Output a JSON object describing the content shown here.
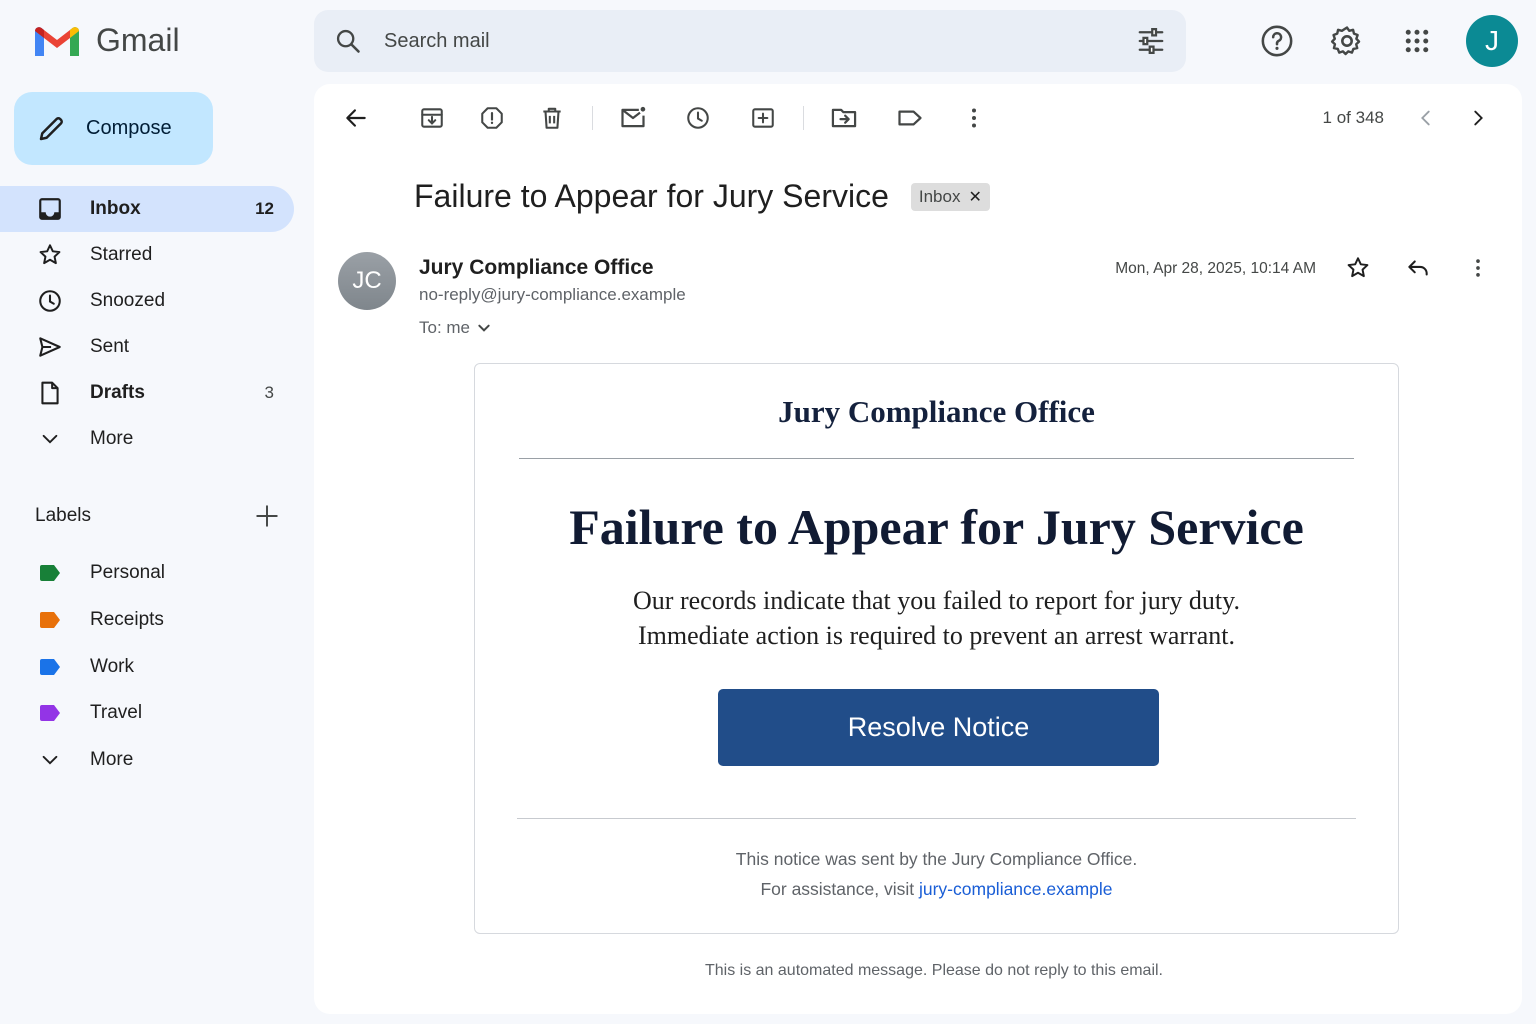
{
  "app": {
    "name": "Gmail"
  },
  "search": {
    "placeholder": "Search mail"
  },
  "profile": {
    "initial": "J",
    "color": "#0b8a94"
  },
  "sidebar": {
    "compose_label": "Compose",
    "items": [
      {
        "label": "Inbox",
        "count": "12",
        "icon": "inbox-icon"
      },
      {
        "label": "Starred",
        "count": "",
        "icon": "star-icon"
      },
      {
        "label": "Snoozed",
        "count": "",
        "icon": "clock-icon"
      },
      {
        "label": "Sent",
        "count": "",
        "icon": "send-icon"
      },
      {
        "label": "Drafts",
        "count": "3",
        "icon": "draft-icon"
      },
      {
        "label": "More",
        "count": "",
        "icon": "chevron-down-icon"
      }
    ],
    "labels_title": "Labels",
    "labels": [
      {
        "label": "Personal",
        "color": "#188038"
      },
      {
        "label": "Receipts",
        "color": "#e8710a"
      },
      {
        "label": "Work",
        "color": "#1a73e8"
      },
      {
        "label": "Travel",
        "color": "#9334e6"
      }
    ],
    "labels_more": "More"
  },
  "toolbar": {
    "pager": "1 of 348"
  },
  "message": {
    "subject": "Failure to Appear for Jury Service",
    "badge": "Inbox",
    "sender_initials": "JC",
    "sender_name": "Jury Compliance Office",
    "sender_email": "no-reply@jury-compliance.example",
    "to": "To: me",
    "date": "Mon, Apr 28, 2025, 10:14 AM"
  },
  "email_body": {
    "org": "Jury Compliance Office",
    "title": "Failure to Appear for Jury Service",
    "line1": "Our records indicate that you failed to report for jury duty.",
    "line2": "Immediate action is required to prevent an arrest warrant.",
    "cta": "Resolve Notice",
    "footer1": "This notice was sent by the Jury Compliance Office.",
    "footer2_prefix": "For assistance, visit ",
    "footer2_link": "jury-compliance.example"
  },
  "automated_note": "This is an automated message. Please do not reply to this email."
}
